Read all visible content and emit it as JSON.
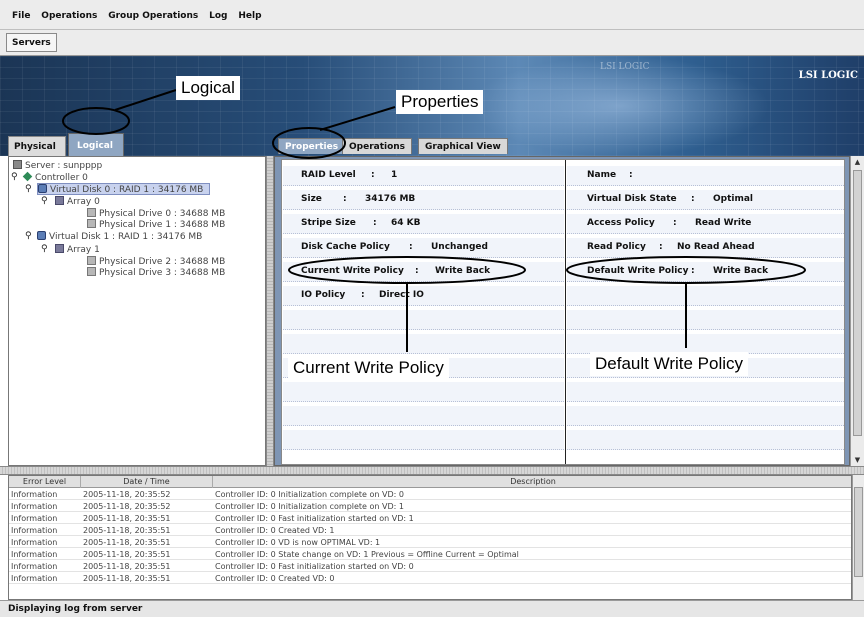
{
  "menu": [
    "File",
    "Operations",
    "Group Operations",
    "Log",
    "Help"
  ],
  "toolbar": {
    "servers_label": "Servers"
  },
  "banner": {
    "logo": "LSI LOGIC",
    "logo_faint": "LSI LOGIC"
  },
  "left_tabs": {
    "physical": "Physical",
    "logical": "Logical"
  },
  "tree": {
    "server": "Server : sunpppp",
    "controller": "Controller 0",
    "vd0": "Virtual Disk 0 : RAID 1 : 34176 MB",
    "array0": "Array 0",
    "pd0": "Physical Drive 0 : 34688 MB",
    "pd1": "Physical Drive 1 : 34688 MB",
    "vd1": "Virtual Disk 1 : RAID 1 : 34176 MB",
    "array1": "Array 1",
    "pd2": "Physical Drive 2 : 34688 MB",
    "pd3": "Physical Drive 3 : 34688 MB"
  },
  "right_tabs": {
    "properties": "Properties",
    "operations": "Operations",
    "graphical": "Graphical View"
  },
  "properties": {
    "left": [
      {
        "label": "RAID Level",
        "value": "1"
      },
      {
        "label": "Size",
        "value": "34176 MB"
      },
      {
        "label": "Stripe Size",
        "value": "64 KB"
      },
      {
        "label": "Disk Cache Policy",
        "value": "Unchanged"
      },
      {
        "label": "Current Write Policy",
        "value": "Write Back"
      },
      {
        "label": "IO Policy",
        "value": "Direct IO"
      }
    ],
    "right": [
      {
        "label": "Name",
        "value": ""
      },
      {
        "label": "Virtual Disk State",
        "value": "Optimal"
      },
      {
        "label": "Access Policy",
        "value": "Read Write"
      },
      {
        "label": "Read Policy",
        "value": "No Read Ahead"
      },
      {
        "label": "Default Write Policy",
        "value": "Write Back"
      }
    ]
  },
  "log": {
    "headers": [
      "Error Level",
      "Date / Time",
      "Description"
    ],
    "rows": [
      [
        "Information",
        "2005-11-18, 20:35:52",
        "Controller ID:  0   Initialization complete on VD:  0"
      ],
      [
        "Information",
        "2005-11-18, 20:35:52",
        "Controller ID:  0   Initialization complete on VD:  1"
      ],
      [
        "Information",
        "2005-11-18, 20:35:51",
        "Controller ID:  0   Fast initialization started on VD:  1"
      ],
      [
        "Information",
        "2005-11-18, 20:35:51",
        "Controller ID:  0   Created VD:  1"
      ],
      [
        "Information",
        "2005-11-18, 20:35:51",
        "Controller ID:  0   VD is now OPTIMAL   VD:  1"
      ],
      [
        "Information",
        "2005-11-18, 20:35:51",
        "Controller ID:  0   State change on VD:  1  Previous  =  Offline  Current  =  Optimal"
      ],
      [
        "Information",
        "2005-11-18, 20:35:51",
        "Controller ID:  0   Fast initialization started on VD:  0"
      ],
      [
        "Information",
        "2005-11-18, 20:35:51",
        "Controller ID:  0   Created VD:  0"
      ]
    ]
  },
  "status": "Displaying log from server",
  "callouts": {
    "logical": "Logical",
    "properties": "Properties",
    "current_write": "Current Write Policy",
    "default_write": "Default Write Policy"
  }
}
